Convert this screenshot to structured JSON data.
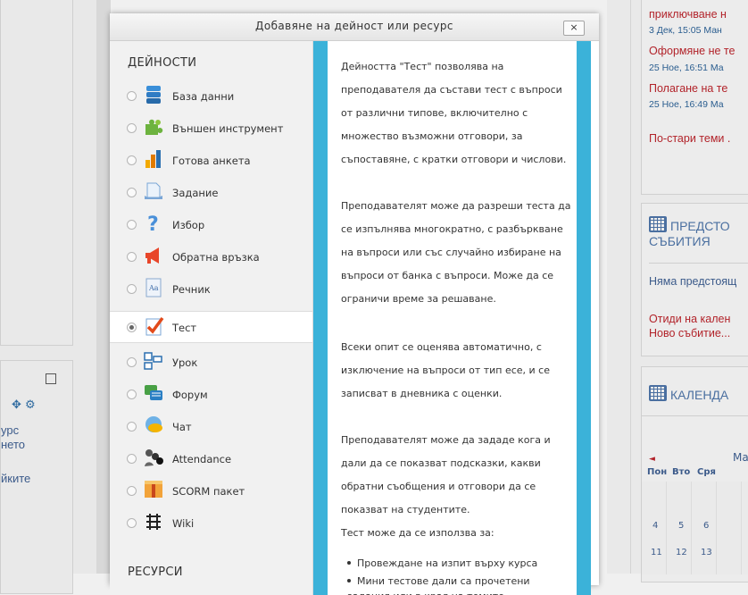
{
  "modal": {
    "title": "Добавяне на дейност или ресурс",
    "close_label": "×",
    "activities_heading": "ДЕЙНОСТИ",
    "resources_heading": "РЕСУРСИ",
    "options": [
      {
        "label": "База данни",
        "icon": "database-icon",
        "selected": false
      },
      {
        "label": "Външен инструмент",
        "icon": "puzzle-icon",
        "selected": false
      },
      {
        "label": "Готова анкета",
        "icon": "bar-chart-icon",
        "selected": false
      },
      {
        "label": "Задание",
        "icon": "assignment-icon",
        "selected": false
      },
      {
        "label": "Избор",
        "icon": "question-icon",
        "selected": false
      },
      {
        "label": "Обратна връзка",
        "icon": "megaphone-icon",
        "selected": false
      },
      {
        "label": "Речник",
        "icon": "glossary-icon",
        "selected": false
      },
      {
        "label": "Тест",
        "icon": "quiz-check-icon",
        "selected": true
      },
      {
        "label": "Урок",
        "icon": "lesson-icon",
        "selected": false
      },
      {
        "label": "Форум",
        "icon": "forum-icon",
        "selected": false
      },
      {
        "label": "Чат",
        "icon": "chat-icon",
        "selected": false
      },
      {
        "label": "Attendance",
        "icon": "attendance-icon",
        "selected": false
      },
      {
        "label": "SCORM пакет",
        "icon": "scorm-package-icon",
        "selected": false
      },
      {
        "label": "Wiki",
        "icon": "wiki-icon",
        "selected": false
      }
    ],
    "description": {
      "p1": "Дейността \"Тест\" позволява на преподавателя да състави тест с въпроси от различни типове, включително с множество възможни отговори, за съпоставяне, с кратки отговори и числови.",
      "p2": "Преподавателят може да разреши теста да се изпълнява многократно, с разбъркване на въпроси или със случайно избиране на въпроси от банка с въпроси. Може да се ограничи време за решаване.",
      "p3": "Всеки опит се оценява автоматично, с изключение на въпроси от тип есе, и се записват в дневника с оценки.",
      "p4": "Преподавателят може да зададе кога и дали да се показват подсказки, какви обратни съобщения и отговори да се показват на студентите.",
      "p5": "Тест може да се използва за:",
      "bullets": [
        "Провеждане на изпит върху курса",
        "Мини тестове дали са прочетени задания или в края на темите"
      ]
    }
  },
  "right": {
    "news_items": [
      {
        "title": "приключване н",
        "meta": "3 Дек, 15:05 Ман"
      },
      {
        "title": "Оформяне не те",
        "meta": "25 Ное, 16:51 Ма"
      },
      {
        "title": "Полагане на те",
        "meta": "25 Ное, 16:49 Ма"
      }
    ],
    "older_topics": "По-стари теми .",
    "events_title_1": "ПРЕДСТО",
    "events_title_2": "СЪБИТИЯ",
    "no_events": "Няма предстоящ",
    "goto_calendar": "Отиди на кален",
    "new_event": "Ново събитие...",
    "calendar_title": "КАЛЕНДА",
    "calendar_month": "Ма",
    "calendar_prev": "◄",
    "weekdays": [
      "Пон",
      "Вто",
      "Сря"
    ],
    "week1": [
      "4",
      "5",
      "6"
    ],
    "week2": [
      "11",
      "12",
      "13"
    ]
  },
  "left": {
    "line1": "урс",
    "line2": "нето",
    "line3": "йките"
  }
}
